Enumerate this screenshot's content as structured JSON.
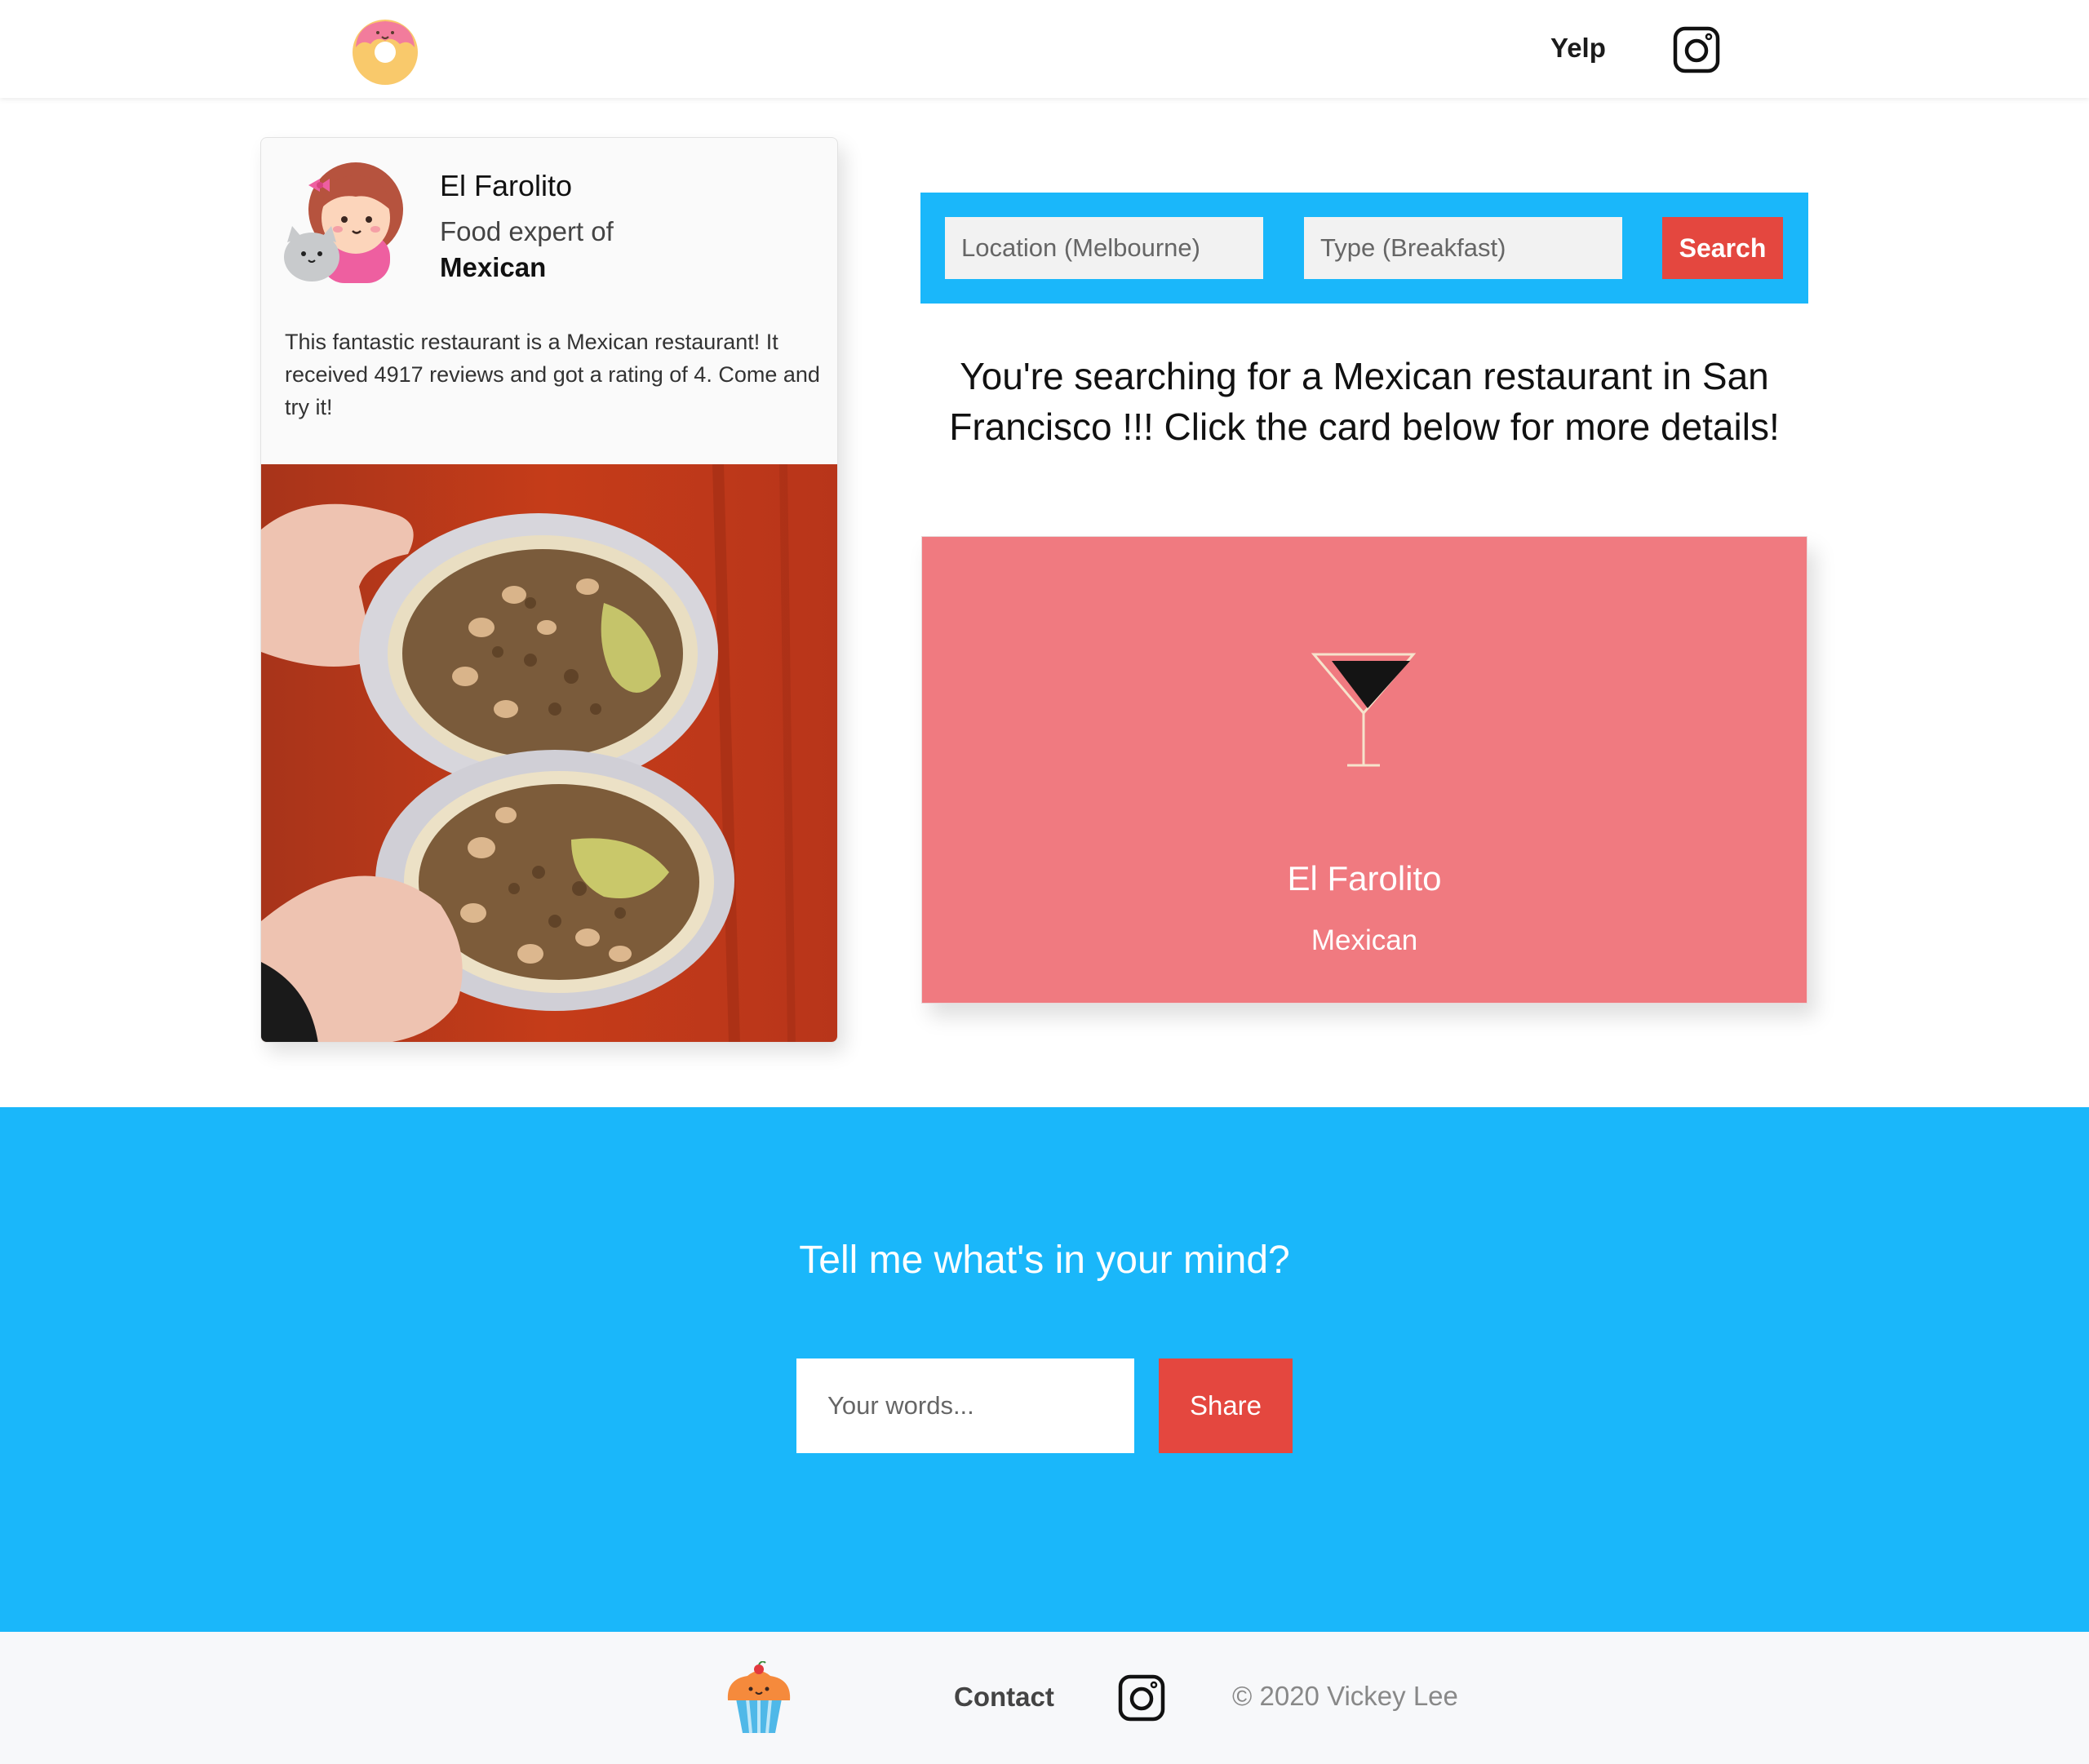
{
  "header": {
    "logo_icon": "donut-logo-icon",
    "nav": {
      "yelp_label": "Yelp",
      "instagram_icon": "instagram-icon"
    }
  },
  "profile_card": {
    "avatar_icon": "girl-with-cat-avatar",
    "name": "El Farolito",
    "role": "Food expert of",
    "cuisine": "Mexican",
    "description": "This fantastic restaurant is a Mexican restaurant! It received 4917 reviews and got a rating of 4. Come and try it!",
    "photo": "burrito-photo"
  },
  "search": {
    "location_placeholder": "Location (Melbourne)",
    "type_placeholder": "Type (Breakfast)",
    "button_label": "Search",
    "accent_color": "#1ab7fa",
    "button_color": "#e4473f"
  },
  "search_message": "You're searching for a Mexican restaurant in San Francisco !!! Click the card below for more details!",
  "result_card": {
    "icon": "cocktail-glass-icon",
    "name": "El Farolito",
    "cuisine": "Mexican",
    "color": "#f07a80"
  },
  "feedback": {
    "title": "Tell me what's in your mind?",
    "input_placeholder": "Your words...",
    "button_label": "Share"
  },
  "footer": {
    "logo_icon": "cupcake-icon",
    "contact_label": "Contact",
    "instagram_icon": "instagram-icon",
    "copyright": "© 2020 Vickey Lee"
  }
}
